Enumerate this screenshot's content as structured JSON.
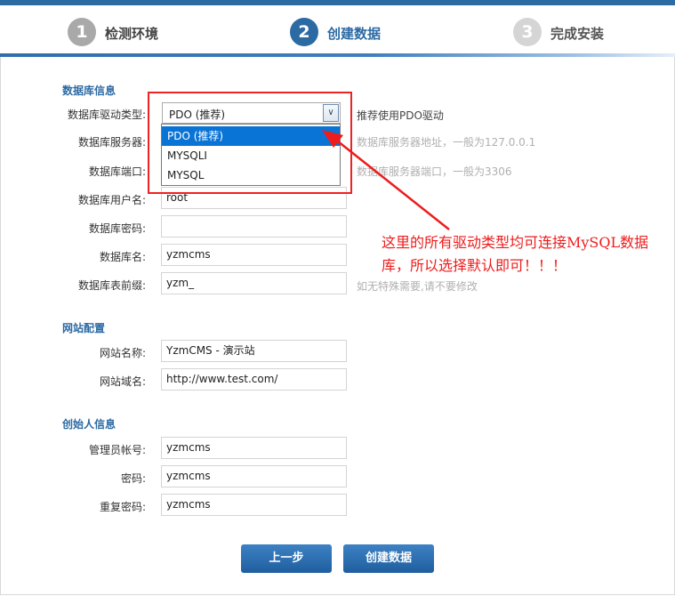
{
  "steps": [
    {
      "num": "1",
      "label": "检测环境"
    },
    {
      "num": "2",
      "label": "创建数据"
    },
    {
      "num": "3",
      "label": "完成安装"
    }
  ],
  "db": {
    "title": "数据库信息",
    "driver": {
      "label": "数据库驱动类型:",
      "value": "PDO (推荐)",
      "hint": "推荐使用PDO驱动",
      "options": [
        "PDO (推荐)",
        "MYSQLI",
        "MYSQL"
      ]
    },
    "server": {
      "label": "数据库服务器:",
      "value": "",
      "hint": "数据库服务器地址，一般为127.0.0.1"
    },
    "port": {
      "label": "数据库端口:",
      "value": "",
      "hint": "数据库服务器端口，一般为3306"
    },
    "user": {
      "label": "数据库用户名:",
      "value": "root"
    },
    "password": {
      "label": "数据库密码:",
      "value": ""
    },
    "name": {
      "label": "数据库名:",
      "value": "yzmcms"
    },
    "prefix": {
      "label": "数据库表前缀:",
      "value": "yzm_",
      "hint": "如无特殊需要,请不要修改"
    }
  },
  "site": {
    "title": "网站配置",
    "name": {
      "label": "网站名称:",
      "value": "YzmCMS - 演示站"
    },
    "domain": {
      "label": "网站域名:",
      "value": "http://www.test.com/"
    }
  },
  "founder": {
    "title": "创始人信息",
    "account": {
      "label": "管理员帐号:",
      "value": "yzmcms"
    },
    "password": {
      "label": "密码:",
      "value": "yzmcms"
    },
    "repeat": {
      "label": "重复密码:",
      "value": "yzmcms"
    }
  },
  "buttons": {
    "prev": "上一步",
    "create": "创建数据"
  },
  "annotation": "这里的所有驱动类型均可连接MySQL数据库，所以选择默认即可！！！",
  "colors": {
    "primary": "#2c6aa3",
    "highlight": "#0a74d6",
    "annotation": "#ee1c1c"
  }
}
